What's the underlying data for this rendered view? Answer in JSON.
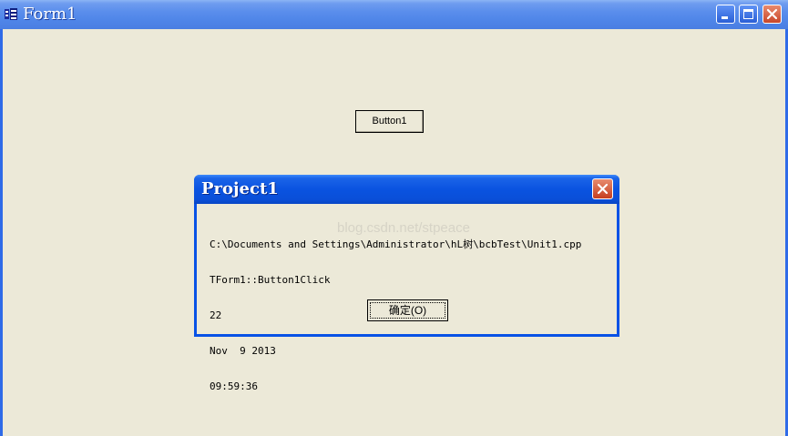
{
  "window": {
    "title": "Form1",
    "app_icon": "borland-app-icon",
    "controls": [
      "minimize-icon",
      "maximize-icon",
      "close-icon"
    ],
    "colors": {
      "titlebar": "#4F85E8",
      "client": "#ECE9D8"
    }
  },
  "form": {
    "button1_label": "Button1"
  },
  "dialog": {
    "title": "Project1",
    "close_icon": "close-icon",
    "lines": [
      "C:\\Documents and Settings\\Administrator\\hL树\\bcbTest\\Unit1.cpp",
      "TForm1::Button1Click",
      "22",
      "Nov  9 2013",
      "09:59:36"
    ],
    "watermark": "blog.csdn.net/stpeace",
    "ok_label": "确定(O)",
    "colors": {
      "titlebar": "#0A53E0",
      "close": "#C53E20"
    }
  }
}
